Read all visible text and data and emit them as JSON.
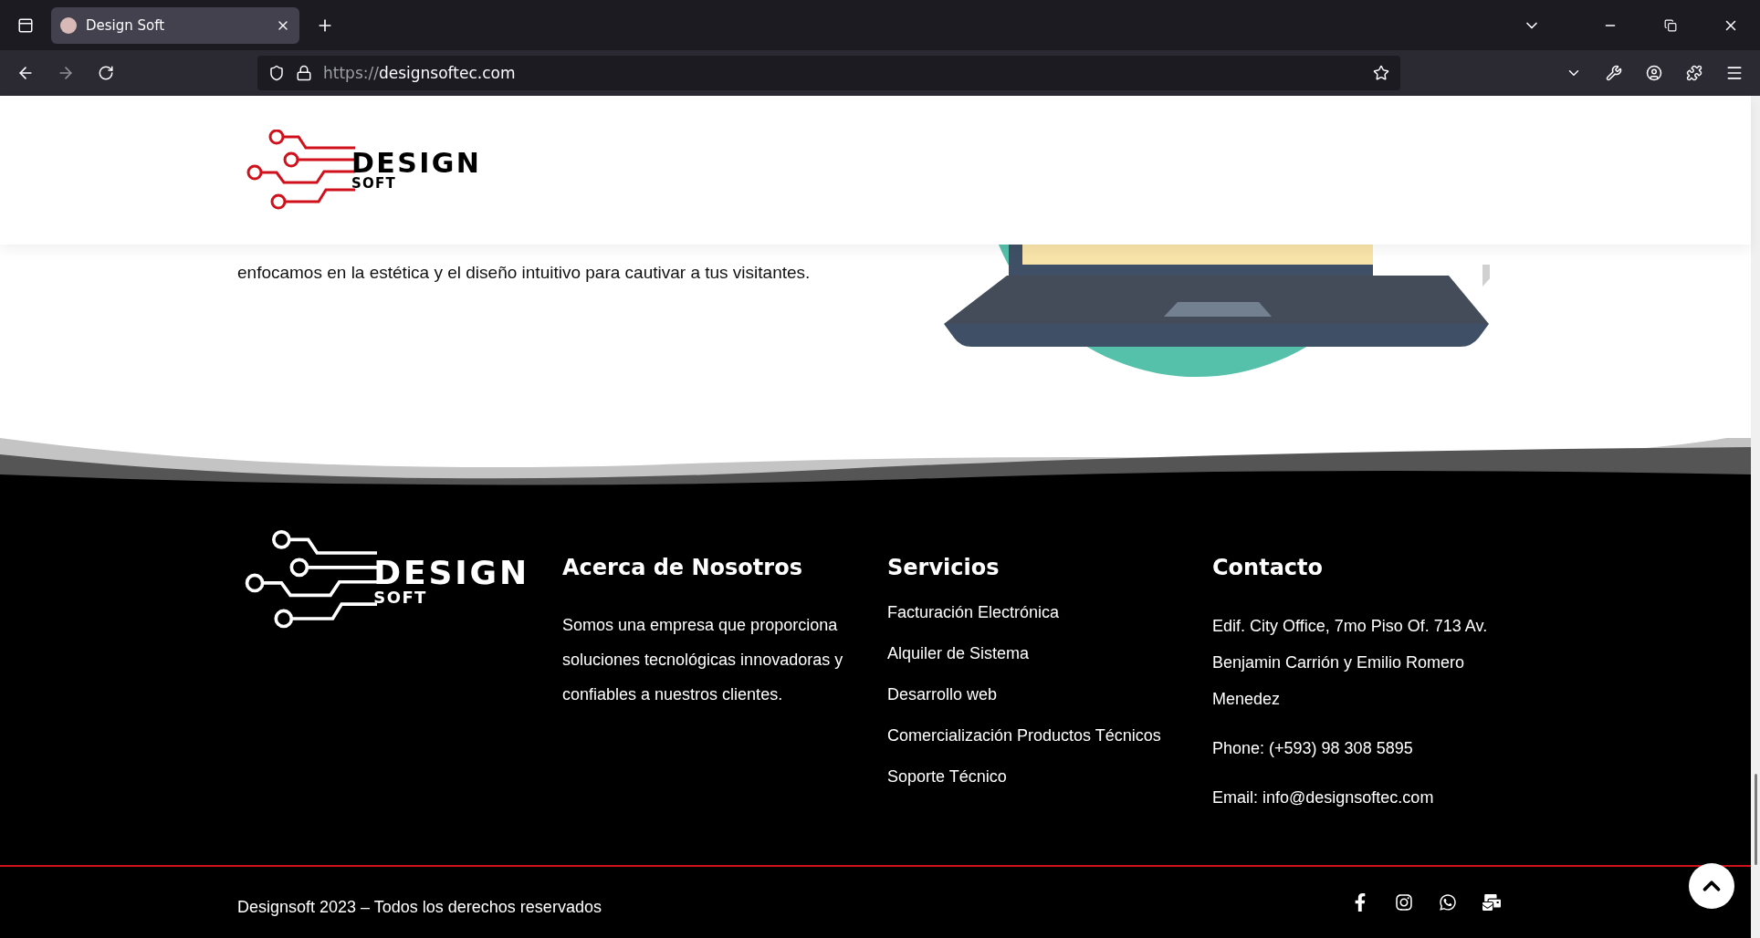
{
  "browser": {
    "tabs": [
      {
        "title": "Design Soft",
        "selected": true
      }
    ],
    "url": {
      "scheme": "https://",
      "host": "designsoftec.com"
    }
  },
  "header": {
    "logo": {
      "word": "DESIGN",
      "subword": "SOFT"
    }
  },
  "intro": {
    "text": "enfocamos en la estética y el diseño intuitivo para cautivar a tus visitantes."
  },
  "footer": {
    "logo": {
      "word": "DESIGN",
      "subword": "SOFT"
    },
    "columns": [
      {
        "kind": "text",
        "heading": "Acerca de Nosotros",
        "paragraph": "Somos una empresa que proporciona soluciones tecnológicas innovadoras y confiables a nuestros clientes."
      },
      {
        "kind": "links",
        "heading": "Servicios",
        "items": [
          "Facturación Electrónica",
          "Alquiler de Sistema",
          "Desarrollo web",
          "Comercialización Productos Técnicos",
          "Soporte Técnico"
        ]
      },
      {
        "kind": "contact",
        "heading": "Contacto",
        "items": [
          "Edif. City Office, 7mo Piso Of. 713 Av. Benjamin Carrión y Emilio Romero Menedez",
          "Phone: (+593) 98 308 5895",
          "Email: info@designsoftec.com"
        ]
      }
    ],
    "copyright": "Designsoft 2023 – Todos los derechos reservados"
  }
}
